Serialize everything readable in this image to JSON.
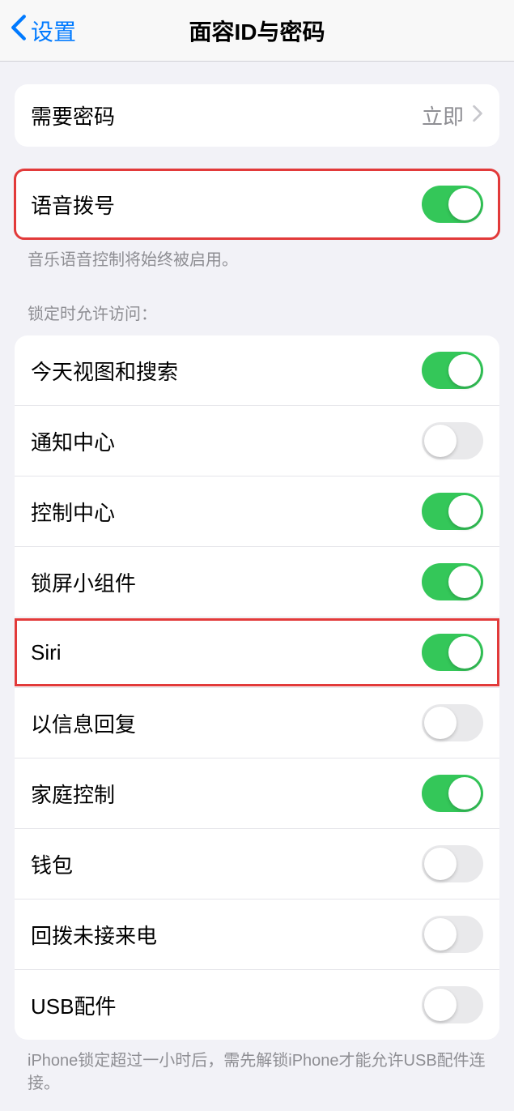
{
  "nav": {
    "back_label": "设置",
    "title": "面容ID与密码"
  },
  "require_passcode": {
    "label": "需要密码",
    "value": "立即"
  },
  "voice_dial": {
    "label": "语音拨号",
    "on": true,
    "footer": "音乐语音控制将始终被启用。"
  },
  "lock_access": {
    "header": "锁定时允许访问：",
    "items": [
      {
        "label": "今天视图和搜索",
        "on": true
      },
      {
        "label": "通知中心",
        "on": false
      },
      {
        "label": "控制中心",
        "on": true
      },
      {
        "label": "锁屏小组件",
        "on": true
      },
      {
        "label": "Siri",
        "on": true,
        "highlight": true
      },
      {
        "label": "以信息回复",
        "on": false
      },
      {
        "label": "家庭控制",
        "on": true
      },
      {
        "label": "钱包",
        "on": false
      },
      {
        "label": "回拨未接来电",
        "on": false
      },
      {
        "label": "USB配件",
        "on": false
      }
    ],
    "footer": "iPhone锁定超过一小时后，需先解锁iPhone才能允许USB配件连接。"
  }
}
